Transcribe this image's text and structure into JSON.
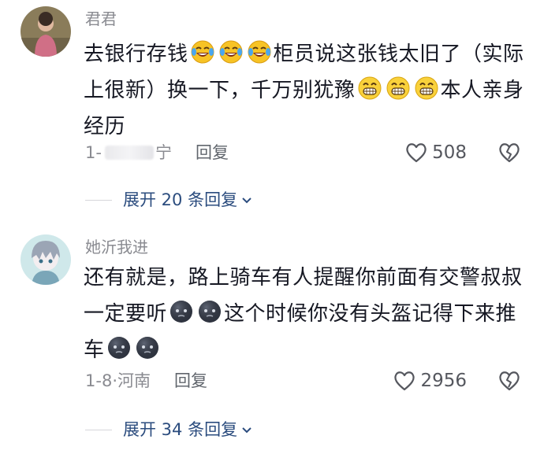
{
  "comments": [
    {
      "username": "君君",
      "text_segments": [
        "去银行存钱",
        "柜员说这张钱太旧了（实际上很新）换一下，千万别犹豫",
        "本人亲身经历"
      ],
      "emoji_1": "laugh-cry-emoji",
      "emoji_2": "grin-emoji",
      "time": "1-",
      "location": "宁",
      "reply_label": "回复",
      "likes": "508",
      "replies_label": "展开 20 条回复"
    },
    {
      "username": "她沂我进",
      "text_segments": [
        "还有就是，路上骑车有人提醒你前面有交警叔叔一定要听",
        "这个时候你没有头盔记得下来推车"
      ],
      "emoji": "dark-face-emoji",
      "time": "1-8",
      "location": "河南",
      "reply_label": "回复",
      "likes": "2956",
      "replies_label": "展开 34 条回复"
    }
  ],
  "colors": {
    "text": "#161823",
    "meta": "#8a8b91",
    "link": "#2b4c7e"
  }
}
